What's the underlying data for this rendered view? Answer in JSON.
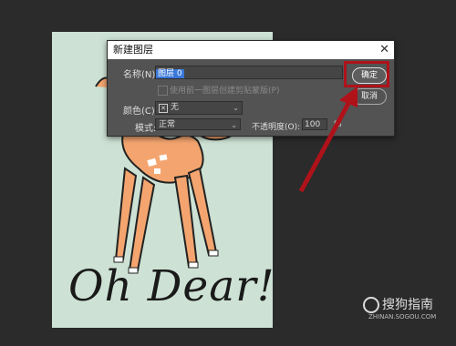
{
  "dialog": {
    "title": "新建图层",
    "close_glyph": "✕",
    "name_label": "名称(N):",
    "name_value": "图层 0",
    "clip_checkbox_label": "使用前一图层创建剪贴蒙版(P)",
    "color_label": "颜色(C):",
    "color_value": "无",
    "mode_label": "模式:",
    "mode_value": "正常",
    "opacity_label": "不透明度(O):",
    "opacity_value": "100",
    "opacity_unit": "%",
    "ok_label": "确定",
    "cancel_label": "取消"
  },
  "artwork": {
    "caption": "Oh Dear!"
  },
  "watermark": {
    "brand": "搜狗指南",
    "url": "ZHINAN.SOGOU.COM"
  },
  "colors": {
    "highlight": "#b0121a",
    "canvas_bg": "#cde2d4",
    "deer": "#f4a56f"
  }
}
